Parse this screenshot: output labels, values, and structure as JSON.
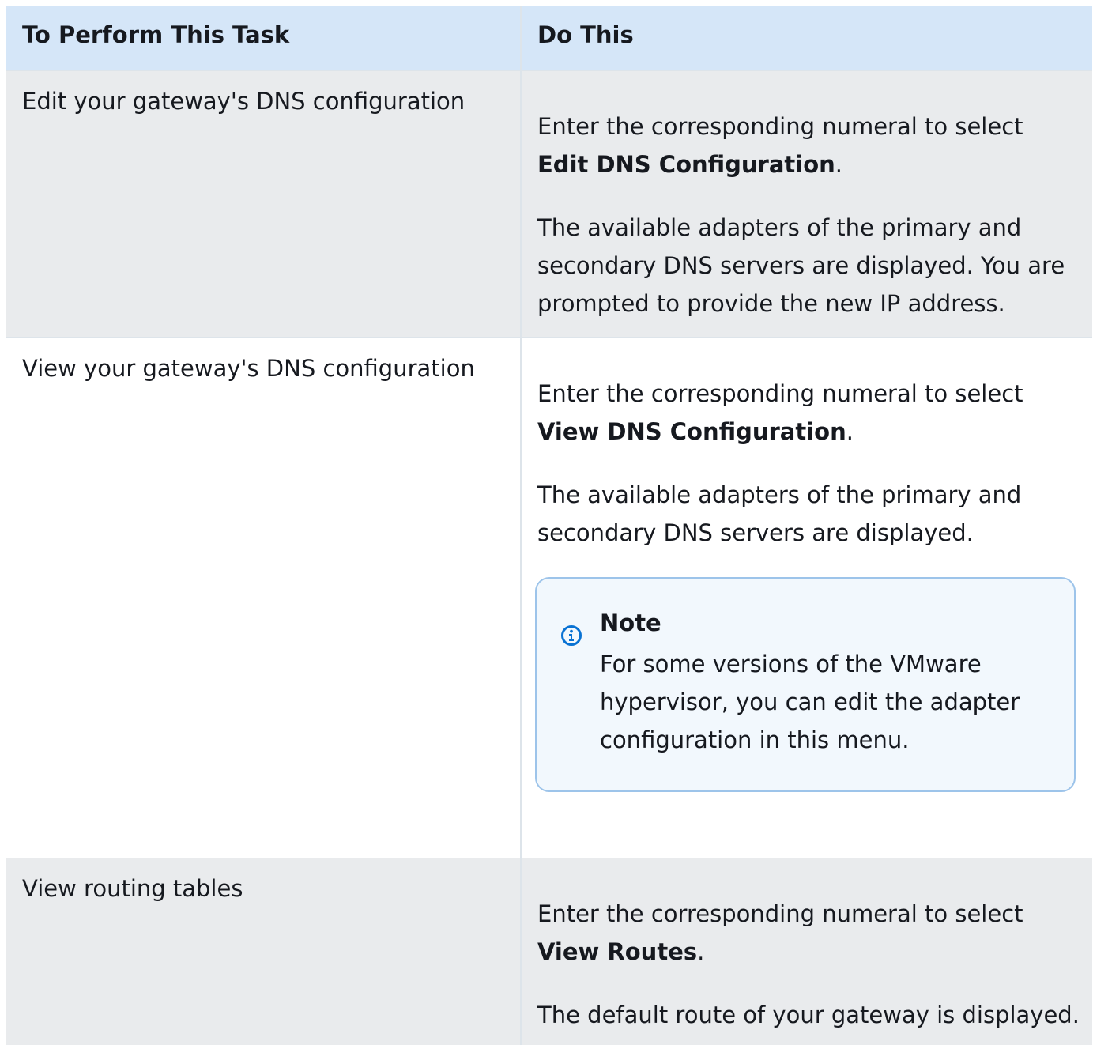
{
  "table": {
    "headers": [
      "To Perform This Task",
      "Do This"
    ],
    "rows": [
      {
        "task": "Edit your gateway's DNS configuration",
        "step_prefix": "Enter the corresponding numeral to select",
        "step_bold": "Edit  DNS Configuration",
        "step_suffix": ".",
        "detail": "The available adapters of the primary and secondary DNS  servers are displayed. You are prompted to provide the new  IP address."
      },
      {
        "task": "View your gateway's DNS configuration",
        "step_prefix": "Enter the corresponding numeral to select",
        "step_bold": "View  DNS Configuration",
        "step_suffix": ".",
        "detail": "The available adapters of the primary and secondary DNS  servers are displayed.",
        "note": {
          "title": "Note",
          "body": "For some versions of the VMware hypervisor, you can  edit the adapter configuration in this menu.",
          "icon": "info-icon",
          "accent_color": "#0972d3"
        }
      },
      {
        "task": "View routing tables",
        "step_prefix": "Enter the corresponding numeral to select",
        "step_bold": "View  Routes",
        "step_suffix": ".",
        "detail": "The default route of your gateway is displayed."
      }
    ]
  }
}
